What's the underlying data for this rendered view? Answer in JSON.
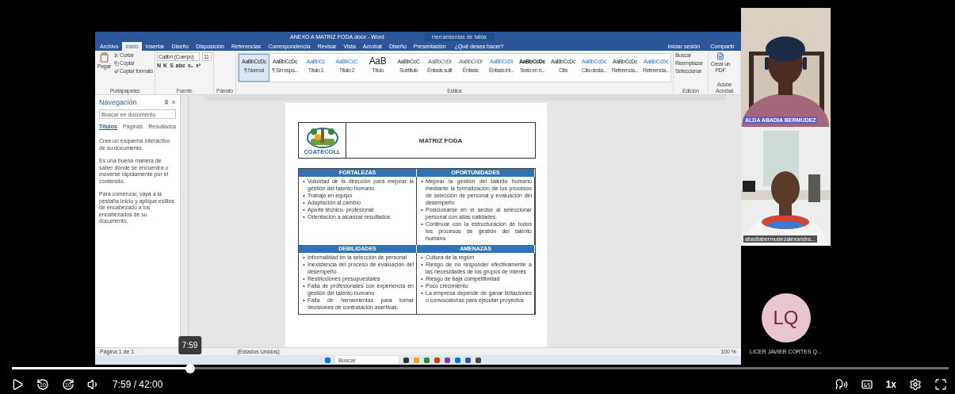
{
  "word": {
    "title": "ANEXO A MATRIZ FODA.docx - Word",
    "context_title": "Herramientas de tabla",
    "tabs": [
      {
        "label": "Archivo",
        "selected": false
      },
      {
        "label": "Inicio",
        "selected": true
      },
      {
        "label": "Insertar",
        "selected": false
      },
      {
        "label": "Diseño",
        "selected": false
      },
      {
        "label": "Disposición",
        "selected": false
      },
      {
        "label": "Referencias",
        "selected": false
      },
      {
        "label": "Correspondencia",
        "selected": false
      },
      {
        "label": "Revisar",
        "selected": false
      },
      {
        "label": "Vista",
        "selected": false
      },
      {
        "label": "Acrobat",
        "selected": false
      },
      {
        "label": "Diseño",
        "selected": false
      },
      {
        "label": "Presentación",
        "selected": false
      }
    ],
    "tell_me": "¿Qué desea hacer?",
    "sign_in": "Iniciar sesión",
    "share": "Compartir",
    "clipboard": {
      "paste": "Pegar",
      "items": [
        "Cortar",
        "Copiar",
        "Copiar formato"
      ],
      "label": "Portapapeles"
    },
    "font": {
      "family": "Calibri (Cuerpo)",
      "size": "11",
      "format_keys": [
        "N",
        "K",
        "S",
        "abc",
        "x₂",
        "x²"
      ],
      "label": "Fuente"
    },
    "paragraph": {
      "label": "Párrafo"
    },
    "styles": {
      "label": "Estilos",
      "items": [
        {
          "sample": "AaBbCcDc",
          "name": "¶ Normal",
          "kind": "body",
          "selected": true
        },
        {
          "sample": "AaBbCcDc",
          "name": "¶ Sin espa...",
          "kind": "body",
          "selected": false
        },
        {
          "sample": "AaBbCc",
          "name": "Título 1",
          "kind": "heading",
          "selected": false
        },
        {
          "sample": "AaBbCcC",
          "name": "Título 2",
          "kind": "heading",
          "selected": false
        },
        {
          "sample": "AaB",
          "name": "Título",
          "kind": "title",
          "selected": false
        },
        {
          "sample": "AaBbCcC",
          "name": "Subtítulo",
          "kind": "body",
          "selected": false
        },
        {
          "sample": "AaBbCcDi",
          "name": "Énfasis sutil",
          "kind": "emphasis",
          "selected": false
        },
        {
          "sample": "AaBbCcDi",
          "name": "Énfasis",
          "kind": "emphasis",
          "selected": false
        },
        {
          "sample": "AaBbCcDi",
          "name": "Énfasis int...",
          "kind": "heading",
          "selected": false
        },
        {
          "sample": "AaBbCcDc",
          "name": "Texto en n...",
          "kind": "strong",
          "selected": false
        },
        {
          "sample": "AaBbCcDc",
          "name": "Cita",
          "kind": "body",
          "selected": false
        },
        {
          "sample": "AaBbCcDc",
          "name": "Cita desta...",
          "kind": "heading",
          "selected": false
        },
        {
          "sample": "AaBbCcDc",
          "name": "Referencia...",
          "kind": "body",
          "selected": false
        },
        {
          "sample": "AaBbCcDc",
          "name": "Referencia...",
          "kind": "heading",
          "selected": false
        }
      ]
    },
    "editing": {
      "items": [
        "Buscar",
        "Reemplazar",
        "Seleccionar"
      ],
      "label": "Edición"
    },
    "acrobat": {
      "button": "Crear un PDF",
      "label": "Adobe Acrobat"
    },
    "navigation": {
      "title": "Navegación",
      "placeholder": "Buscar en documento",
      "tabs": [
        {
          "label": "Títulos",
          "selected": true
        },
        {
          "label": "Páginas",
          "selected": false
        },
        {
          "label": "Resultados",
          "selected": false
        }
      ],
      "paragraphs": [
        "Cree un esquema interactivo de su documento.",
        "Es una buena manera de saber dónde se encuentra o moverse rápidamente por el contenido.",
        "Para comenzar, vaya a la pestaña Inicio y aplique estilos de encabezado a los encabezados de su documento."
      ]
    },
    "document": {
      "bullet": "•",
      "logo_text": "COATECOLL",
      "heading": "MATRIZ FODA",
      "quadrants": [
        {
          "title": "FORTALEZAS",
          "items": [
            "Voluntad de la dirección para mejorar la gestión del talento humano.",
            "Trabajo en equipo",
            "Adaptación al cambio",
            "Aporte técnico- profesional",
            "Orientación a alcanzar resultados"
          ]
        },
        {
          "title": "OPORTUNIDADES",
          "items": [
            "Mejorar la gestión del talento humano mediante la formalización de los procesos de selección de personal y evaluación del desempeño",
            "Posicionarse en el sector al seleccionar personal con altas calidades.",
            "Continuar con la estructuración de todos los procesos de gestión del talento humano"
          ]
        },
        {
          "title": "DEBILIDADES",
          "items": [
            "Informalidad en la selección de personal",
            "Inexistencia del proceso de evaluación del desempeño",
            "Restricciones presupuestales",
            "Falta de profesionales con experiencia en gestión del talento humano",
            "Falta de herramientas  para tomar decisiones de contratación asertivas."
          ]
        },
        {
          "title": "AMENAZAS",
          "items": [
            "Cultura de la región",
            "Riesgo de no responder efectivamente a las necesidades de los grupos de interés",
            "Riesgo de baja competitividad",
            "Poco crecimiento",
            "La empresa depende de ganar licitaciones o convocatorias para ejecutar proyectos"
          ]
        }
      ]
    },
    "status_bar": {
      "page": "Página 1 de 1",
      "language": "(Estados Unidos)",
      "zoom": "100 %"
    },
    "taskbar": {
      "search_placeholder": "Buscar"
    }
  },
  "participants": [
    {
      "kind": "video",
      "name": "ALDA ABADIA BERMUDEZ",
      "speaking": true
    },
    {
      "kind": "video",
      "name": "abadiabermudezalexandra...",
      "speaking": false
    },
    {
      "kind": "avatar",
      "initials": "LQ",
      "name": "LICER JAVIER CORTES Q..."
    }
  ],
  "player": {
    "progress": {
      "level": 0.19
    },
    "tooltip": "7:59",
    "skip_back": "10",
    "skip_forward": "10",
    "time": "7:59 / 42:00",
    "speed": "1x"
  }
}
